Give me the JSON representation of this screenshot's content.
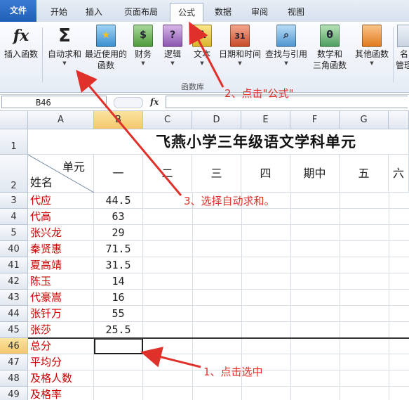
{
  "ribbon": {
    "tabs": [
      "文件",
      "开始",
      "插入",
      "页面布局",
      "公式",
      "数据",
      "审阅",
      "视图"
    ],
    "active_tab": "公式",
    "buttons": {
      "insert_function": "插入函数",
      "autosum": "自动求和",
      "recent": [
        "最近使用的",
        "函数"
      ],
      "financial": "财务",
      "logical": "逻辑",
      "text": "文本",
      "datetime": "日期和时间",
      "lookup": "查找与引用",
      "math": [
        "数学和",
        "三角函数"
      ],
      "more": "其他函数",
      "names": [
        "名",
        "管理"
      ]
    },
    "group_label": "函数库"
  },
  "formula_bar": {
    "name_box": "B46",
    "fx": "fx",
    "formula": ""
  },
  "sheet": {
    "columns": [
      "A",
      "B",
      "C",
      "D",
      "E",
      "F",
      "G"
    ],
    "title": "飞燕小学三年级语文学科单元",
    "header": {
      "unit": "单元",
      "name": "姓名",
      "cols": [
        "一",
        "二",
        "三",
        "四",
        "期中",
        "五",
        "六"
      ]
    },
    "row_numbers": [
      "1",
      "2",
      "3",
      "4",
      "5",
      "40",
      "41",
      "42",
      "43",
      "44",
      "45",
      "46",
      "47",
      "48",
      "49"
    ],
    "students": [
      {
        "name": "代应",
        "score": "44.5"
      },
      {
        "name": "代高",
        "score": "63"
      },
      {
        "name": "张兴龙",
        "score": "29"
      },
      {
        "name": "秦贤惠",
        "score": "71.5"
      },
      {
        "name": "夏高靖",
        "score": "31.5"
      },
      {
        "name": "陈玉",
        "score": "14"
      },
      {
        "name": "代豪嵩",
        "score": "16"
      },
      {
        "name": "张钎万",
        "score": "55"
      },
      {
        "name": "张莎",
        "score": "25.5"
      }
    ],
    "summary_rows": [
      "总分",
      "平均分",
      "及格人数",
      "及格率"
    ]
  },
  "annotations": {
    "step1": "1、点击选中",
    "step2": "2、点击\"公式\"",
    "step3": "3、选择自动求和。"
  },
  "colors": {
    "annotation": "#e0302a",
    "file_tab": "#2a6cc4",
    "student_name": "#cc0000"
  }
}
